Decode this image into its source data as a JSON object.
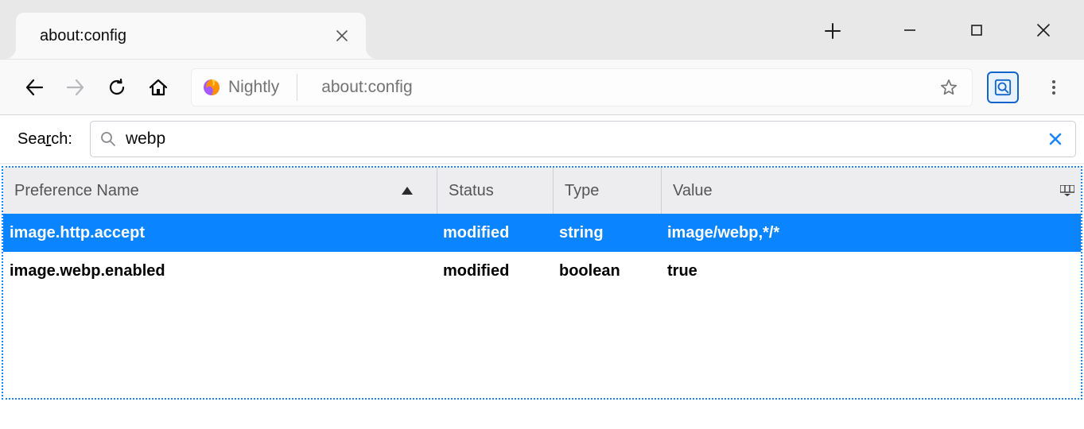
{
  "window": {
    "tab_title": "about:config"
  },
  "toolbar": {
    "brand_label": "Nightly",
    "url": "about:config"
  },
  "search": {
    "label_prefix": "Sea",
    "label_underlined": "r",
    "label_suffix": "ch:",
    "value": "webp"
  },
  "columns": {
    "name": "Preference Name",
    "status": "Status",
    "type": "Type",
    "value": "Value"
  },
  "prefs": [
    {
      "name": "image.http.accept",
      "status": "modified",
      "type": "string",
      "value": "image/webp,*/*",
      "selected": true
    },
    {
      "name": "image.webp.enabled",
      "status": "modified",
      "type": "boolean",
      "value": "true",
      "selected": false
    }
  ]
}
